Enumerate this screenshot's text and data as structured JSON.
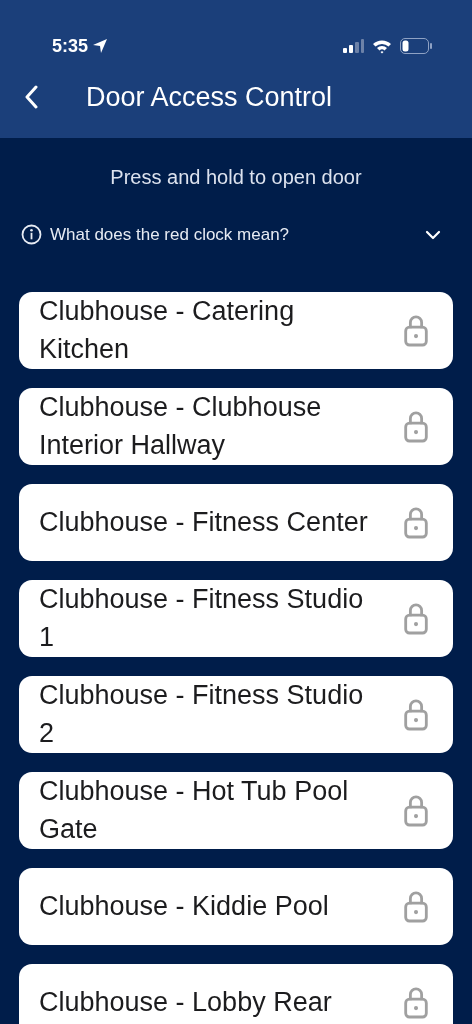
{
  "status_bar": {
    "time": "5:35"
  },
  "header": {
    "title": "Door Access Control"
  },
  "instruction": "Press and hold to open door",
  "info": {
    "question": "What does the red clock mean?",
    "expanded": false
  },
  "doors": [
    {
      "name": "Clubhouse - Catering Kitchen",
      "locked": true
    },
    {
      "name": "Clubhouse - Clubhouse Interior Hallway",
      "locked": true
    },
    {
      "name": "Clubhouse - Fitness Center",
      "locked": true
    },
    {
      "name": "Clubhouse - Fitness Studio 1",
      "locked": true
    },
    {
      "name": "Clubhouse - Fitness Studio 2",
      "locked": true
    },
    {
      "name": "Clubhouse - Hot Tub Pool Gate",
      "locked": true
    },
    {
      "name": "Clubhouse - Kiddie Pool",
      "locked": true
    },
    {
      "name": "Clubhouse - Lobby Rear",
      "locked": true
    }
  ]
}
